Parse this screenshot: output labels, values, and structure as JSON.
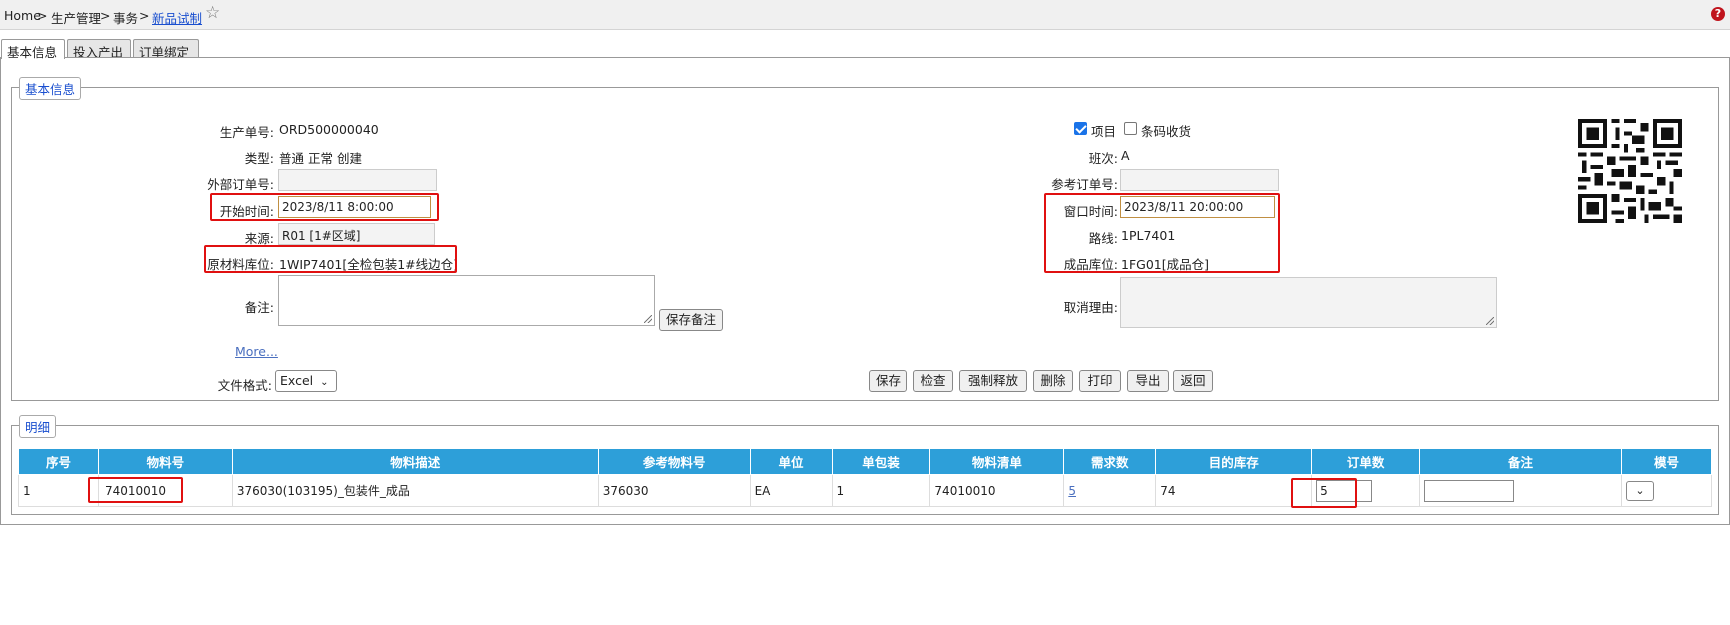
{
  "breadcrumb": {
    "home": "Home",
    "sep": ">",
    "level1": "生产管理",
    "level2": "事务",
    "current": "新品试制"
  },
  "tabs": [
    "基本信息",
    "投入产出",
    "订单绑定"
  ],
  "basic_section": {
    "legend": "基本信息",
    "left": {
      "order_no_label": "生产单号:",
      "order_no": "ORD500000040",
      "type_label": "类型:",
      "type_value": "普通 正常 创建",
      "external_order_label": "外部订单号:",
      "external_order": "",
      "start_time_label": "开始时间:",
      "start_time": "2023/8/11 8:00:00",
      "source_label": "来源:",
      "source": "R01 [1#区域]",
      "raw_location_label": "原材料库位:",
      "raw_location": "1WIP7401[全检包装1#线边仓]",
      "remark_label": "备注:",
      "save_remark_button": "保存备注",
      "more_link": "More...",
      "file_format_label": "文件格式:",
      "file_format": "Excel"
    },
    "right": {
      "project_label": "项目",
      "project_checked": true,
      "barcode_label": "条码收货",
      "barcode_checked": false,
      "shift_label": "班次:",
      "shift": "A",
      "reference_order_label": "参考订单号:",
      "reference_order": "",
      "window_time_label": "窗口时间:",
      "window_time": "2023/8/11 20:00:00",
      "route_label": "路线:",
      "route": "1PL7401",
      "finished_location_label": "成品库位:",
      "finished_location": "1FG01[成品仓]",
      "cancel_reason_label": "取消理由:"
    },
    "actions": [
      "保存",
      "检查",
      "强制释放",
      "删除",
      "打印",
      "导出",
      "返回"
    ]
  },
  "detail_section": {
    "legend": "明细",
    "columns": [
      "序号",
      "物料号",
      "物料描述",
      "参考物料号",
      "单位",
      "单包装",
      "物料清单",
      "需求数",
      "目的库存",
      "订单数",
      "备注",
      "模号"
    ],
    "rows": [
      {
        "seq": "1",
        "material_no": "74010010",
        "description": "376030(103195)_包装件_成品",
        "reference_material": "376030",
        "unit": "EA",
        "unit_pack": "1",
        "bom": "74010010",
        "demand_qty": "5",
        "target_stock": "74",
        "order_qty": "5",
        "remark": "",
        "mold_no": ""
      }
    ]
  },
  "icons": {
    "favorite": "star-outline-icon",
    "help": "question-circle-icon",
    "dropdown": "chevron-down-icon",
    "qr": "qr-code-icon"
  },
  "colors": {
    "header_blue": "#2d9fd9",
    "highlight_red": "#e01010",
    "link_blue": "#1a4fcf"
  }
}
